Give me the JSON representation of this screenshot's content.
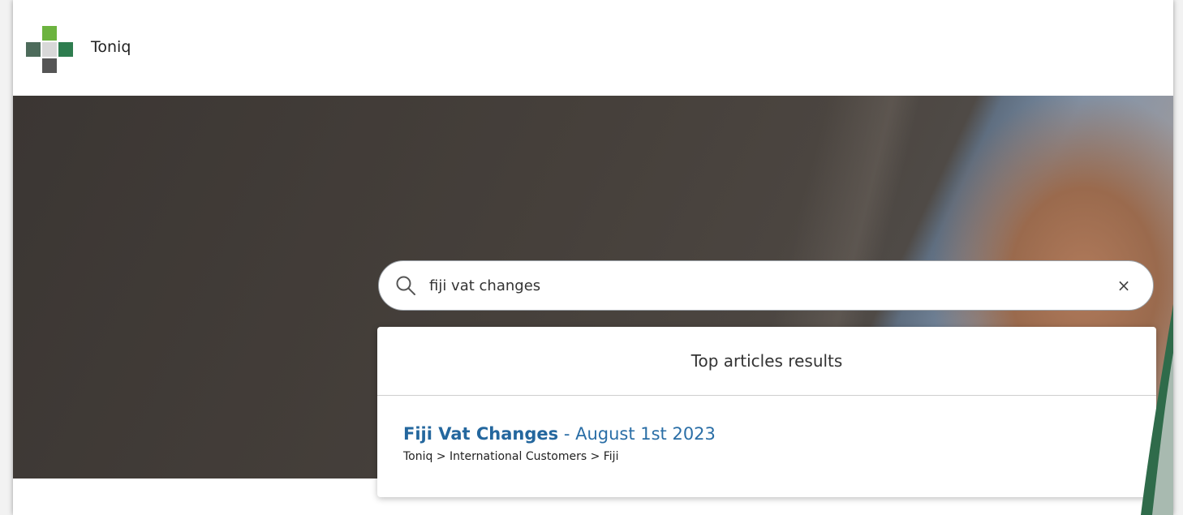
{
  "header": {
    "brand": "Toniq"
  },
  "search": {
    "value": "fiji vat changes",
    "clear_label": "×"
  },
  "results": {
    "heading": "Top articles results",
    "items": [
      {
        "title": "Fiji Vat Changes",
        "separator": " - ",
        "date": "August 1st 2023",
        "breadcrumb": "Toniq > International Customers > Fiji"
      }
    ]
  },
  "colors": {
    "link": "#2a6ea6",
    "logo_light_green": "#6cb33f",
    "logo_dark_green": "#2e7d4f",
    "logo_gray": "#555555"
  }
}
